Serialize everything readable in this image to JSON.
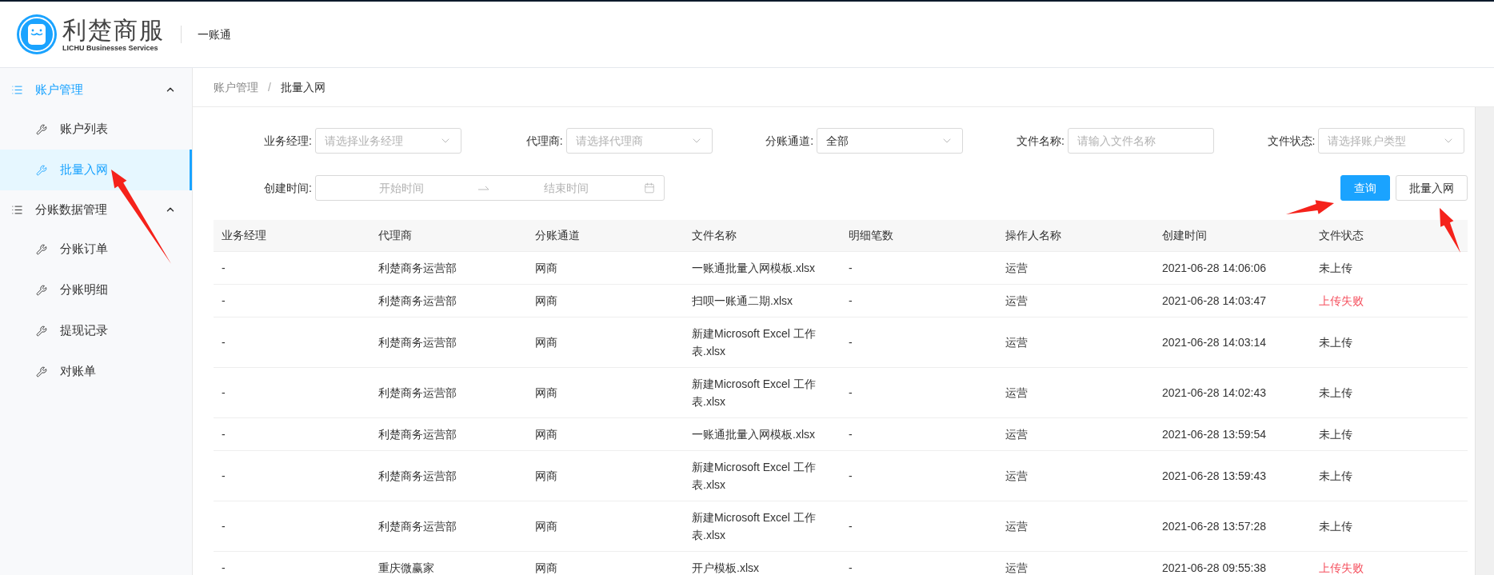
{
  "header": {
    "logo_title": "利楚商服",
    "logo_subtitle": "LICHU Businesses Services",
    "app_name": "一账通"
  },
  "sidebar": {
    "groups": [
      {
        "label": "账户管理",
        "expanded": true,
        "selected": true,
        "children": [
          {
            "label": "账户列表",
            "selected": false
          },
          {
            "label": "批量入网",
            "selected": true
          }
        ]
      },
      {
        "label": "分账数据管理",
        "expanded": true,
        "selected": false,
        "children": [
          {
            "label": "分账订单",
            "selected": false
          },
          {
            "label": "分账明细",
            "selected": false
          },
          {
            "label": "提现记录",
            "selected": false
          },
          {
            "label": "对账单",
            "selected": false
          }
        ]
      }
    ]
  },
  "breadcrumb": {
    "items": [
      "账户管理",
      "批量入网"
    ],
    "separator": "/"
  },
  "filters": [
    {
      "kind": "select",
      "label": "业务经理:",
      "placeholder": "请选择业务经理"
    },
    {
      "kind": "select",
      "label": "代理商:",
      "placeholder": "请选择代理商"
    },
    {
      "kind": "select",
      "label": "分账通道:",
      "value": "全部"
    },
    {
      "kind": "text",
      "label": "文件名称:",
      "placeholder": "请输入文件名称"
    },
    {
      "kind": "select",
      "label": "文件状态:",
      "placeholder": "请选择账户类型"
    },
    {
      "kind": "daterange",
      "label": "创建时间:",
      "start_placeholder": "开始时间",
      "end_placeholder": "结束时间"
    }
  ],
  "buttons": [
    {
      "label": "查询",
      "kind": "primary"
    },
    {
      "label": "批量入网",
      "kind": "default"
    }
  ],
  "table": {
    "columns": [
      "业务经理",
      "代理商",
      "分账通道",
      "文件名称",
      "明细笔数",
      "操作人名称",
      "创建时间",
      "文件状态"
    ],
    "rows": [
      {
        "cells": [
          "-",
          "利楚商务运营部",
          "网商",
          "一账通批量入网模板.xlsx",
          "-",
          "运营",
          "2021-06-28 14:06:06",
          "未上传"
        ],
        "failed": false
      },
      {
        "cells": [
          "-",
          "利楚商务运营部",
          "网商",
          "扫呗一账通二期.xlsx",
          "-",
          "运营",
          "2021-06-28 14:03:47",
          "上传失败"
        ],
        "failed": true
      },
      {
        "cells": [
          "-",
          "利楚商务运营部",
          "网商",
          "新建Microsoft Excel 工作表.xlsx",
          "-",
          "运营",
          "2021-06-28 14:03:14",
          "未上传"
        ],
        "failed": false
      },
      {
        "cells": [
          "-",
          "利楚商务运营部",
          "网商",
          "新建Microsoft Excel 工作表.xlsx",
          "-",
          "运营",
          "2021-06-28 14:02:43",
          "未上传"
        ],
        "failed": false
      },
      {
        "cells": [
          "-",
          "利楚商务运营部",
          "网商",
          "一账通批量入网模板.xlsx",
          "-",
          "运营",
          "2021-06-28 13:59:54",
          "未上传"
        ],
        "failed": false
      },
      {
        "cells": [
          "-",
          "利楚商务运营部",
          "网商",
          "新建Microsoft Excel 工作表.xlsx",
          "-",
          "运营",
          "2021-06-28 13:59:43",
          "未上传"
        ],
        "failed": false
      },
      {
        "cells": [
          "-",
          "利楚商务运营部",
          "网商",
          "新建Microsoft Excel 工作表.xlsx",
          "-",
          "运营",
          "2021-06-28 13:57:28",
          "未上传"
        ],
        "failed": false
      },
      {
        "cells": [
          "-",
          "重庆微赢家",
          "网商",
          "开户模板.xlsx",
          "-",
          "运营",
          "2021-06-28 09:55:38",
          "上传失败"
        ],
        "failed": true
      }
    ]
  }
}
